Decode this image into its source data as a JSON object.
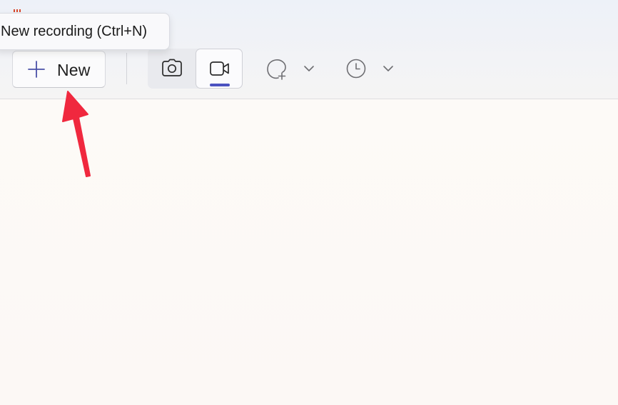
{
  "app": {
    "icon": "snipping-tool-icon"
  },
  "tooltip": {
    "text": "New recording (Ctrl+N)"
  },
  "toolbar": {
    "new_button": {
      "label": "New",
      "icon": "plus-icon"
    },
    "capture_modes": [
      {
        "name": "Snip",
        "icon": "camera-icon",
        "selected": false
      },
      {
        "name": "Record",
        "icon": "video-camera-icon",
        "selected": true
      }
    ],
    "shape_dropdown": {
      "icon": "freeform-shape-icon",
      "chevron": "chevron-down-icon"
    },
    "delay_dropdown": {
      "icon": "clock-icon",
      "chevron": "chevron-down-icon"
    }
  },
  "colors": {
    "accent": "#4b52c0",
    "annotation_arrow": "#f0283e",
    "app_icon": "#d9482c"
  },
  "annotation": {
    "type": "arrow",
    "target": "new-button"
  }
}
